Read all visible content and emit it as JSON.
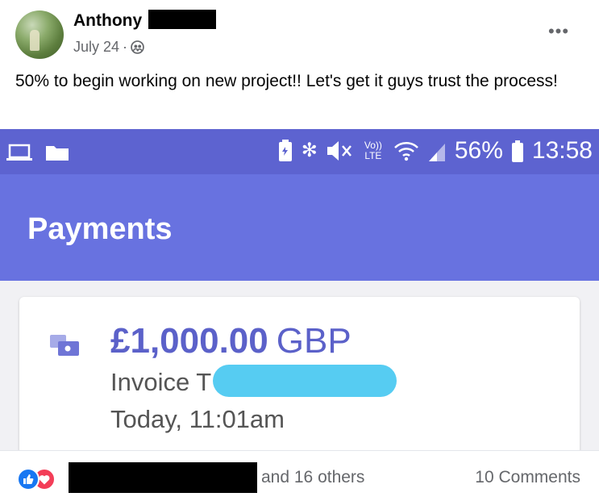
{
  "post": {
    "author": "Anthony",
    "date": "July 24",
    "separator": "·",
    "audience_icon": "friends-globe-icon",
    "more_label": "•••",
    "caption": "50% to begin working on new project!! Let's get it guys trust the process!"
  },
  "phone": {
    "status_left_icons": [
      "laptop-icon",
      "folder-icon"
    ],
    "status_icons": [
      "battery-saver-icon",
      "bluetooth-icon",
      "mute-icon",
      "volte-icon",
      "wifi-icon",
      "signal-icon"
    ],
    "volte_label": "Vo)) LTE",
    "battery": "56%",
    "time": "13:58",
    "app_title": "Payments",
    "card": {
      "amount": "£1,000.00",
      "currency": "GBP",
      "invoice_prefix": "Invoice T",
      "date": "Today, 11:01am"
    }
  },
  "reactions": {
    "icons": [
      "like-icon",
      "love-icon"
    ],
    "others": "and 16 others",
    "comments": "10 Comments"
  },
  "colors": {
    "status_bar": "#5d63d0",
    "app_bar": "#6872e0",
    "amount": "#5b61c9",
    "redaction_blob": "#56ccf2",
    "like": "#1877f2",
    "love": "#f33e58"
  }
}
